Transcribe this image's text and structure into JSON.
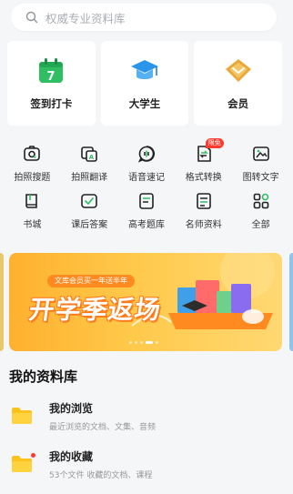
{
  "search": {
    "placeholder": "权威专业资料库",
    "icon": "search-icon"
  },
  "cards": [
    {
      "label": "签到打卡",
      "icon": "calendar-7-icon",
      "color": "#2fbf62"
    },
    {
      "label": "大学生",
      "icon": "graduation-cap-icon",
      "color": "#2b95e9"
    },
    {
      "label": "会员",
      "icon": "diamond-icon",
      "color": "#e9a93a"
    }
  ],
  "tools": [
    {
      "label": "拍照搜题",
      "icon": "camera-search-icon"
    },
    {
      "label": "拍照翻译",
      "icon": "camera-translate-icon"
    },
    {
      "label": "语音速记",
      "icon": "voice-icon"
    },
    {
      "label": "格式转换",
      "icon": "format-convert-icon",
      "badge": "限免"
    },
    {
      "label": "图转文字",
      "icon": "image-to-text-icon"
    },
    {
      "label": "书城",
      "icon": "book-icon"
    },
    {
      "label": "课后答案",
      "icon": "answer-box-icon"
    },
    {
      "label": "高考题库",
      "icon": "exam-bank-icon"
    },
    {
      "label": "名师资料",
      "icon": "teacher-doc-icon"
    },
    {
      "label": "全部",
      "icon": "grid-all-icon"
    }
  ],
  "banner": {
    "pill": "文库会员买一年送半年",
    "title": "开学季返场",
    "slide_count": 5,
    "active_slide": 4
  },
  "library": {
    "title": "我的资料库",
    "items": [
      {
        "title": "我的浏览",
        "subtitle": "最近浏览的文档、文集、音频",
        "icon": "folder-icon"
      },
      {
        "title": "我的收藏",
        "subtitle": "53个文件 收藏的文档、课程",
        "icon": "folder-icon"
      }
    ]
  },
  "colors": {
    "accent_green": "#2fbf62",
    "folder": "#ffc21a",
    "badge_red": "#ff3b30"
  }
}
